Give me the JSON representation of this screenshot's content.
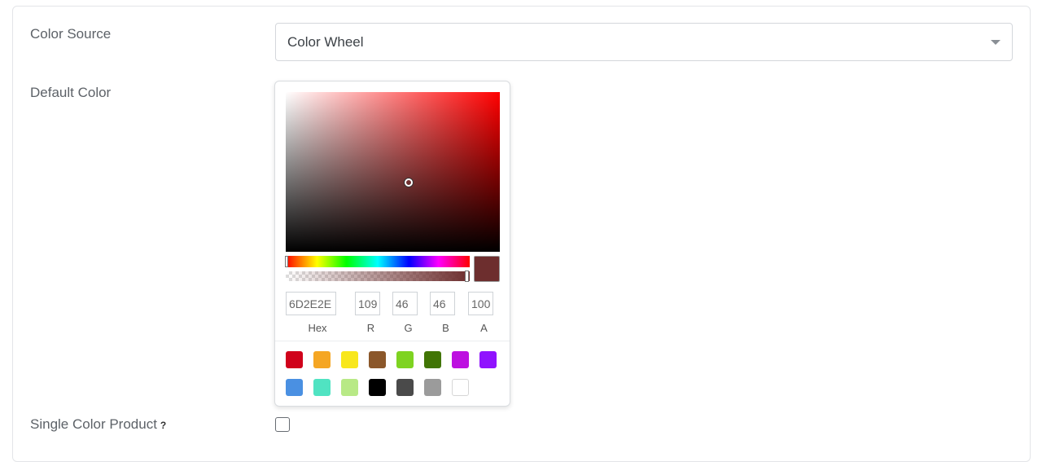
{
  "form": {
    "color_source_label": "Color Source",
    "color_source_value": "Color Wheel",
    "default_color_label": "Default Color",
    "single_color_label": "Single Color Product",
    "single_color_help": "?",
    "single_color_checked": false
  },
  "picker": {
    "hue_color": "#ff0000",
    "selected_color": "#6D2E2E",
    "hex_value": "6D2E2E",
    "r_value": "109",
    "g_value": "46",
    "b_value": "46",
    "a_value": "100",
    "labels": {
      "hex": "Hex",
      "r": "R",
      "g": "G",
      "b": "B",
      "a": "A"
    },
    "swatches_row1": [
      "#d0021b",
      "#f5a623",
      "#f8e71c",
      "#8b572a",
      "#7ed321",
      "#417505",
      "#bd10e0",
      "#9013fe"
    ],
    "swatches_row2": [
      "#4a90e2",
      "#50e3c2",
      "#b8e986",
      "#000000",
      "#4a4a4a",
      "#9b9b9b",
      "#ffffff"
    ]
  }
}
